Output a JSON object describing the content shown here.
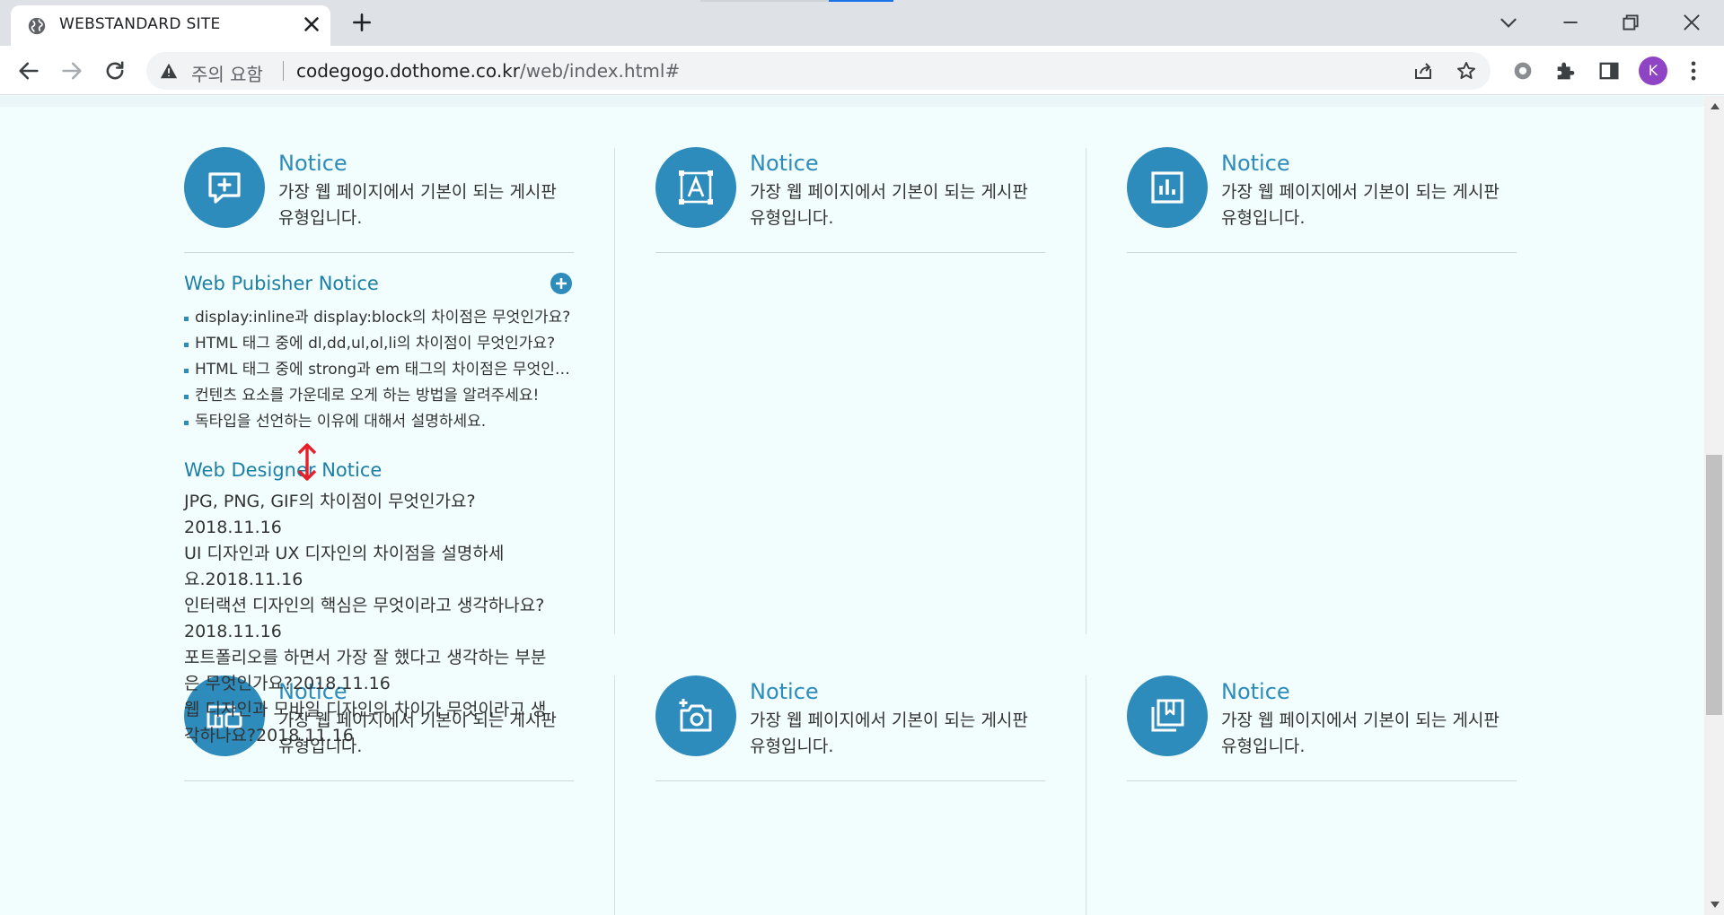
{
  "browser": {
    "tab_title": "WEBSTANDARD SITE",
    "security_label": "주의 요함",
    "url_domain": "codegogo.dothome.co.kr",
    "url_path": "/web/index.html#",
    "profile_initial": "K"
  },
  "notices": [
    {
      "icon": "chat-plus-icon",
      "title": "Notice",
      "desc": "가장 웹 페이지에서 기본이 되는 게시판 유형입니다."
    },
    {
      "icon": "text-frame-icon",
      "title": "Notice",
      "desc": "가장 웹 페이지에서 기본이 되는 게시판 유형입니다."
    },
    {
      "icon": "bar-chart-icon",
      "title": "Notice",
      "desc": "가장 웹 페이지에서 기본이 되는 게시판 유형입니다."
    },
    {
      "icon": "devices-icon",
      "title": "Notice",
      "desc": "가장 웹 페이지에서 기본이 되는 게시판 유형입니다."
    },
    {
      "icon": "camera-plus-icon",
      "title": "Notice",
      "desc": "가장 웹 페이지에서 기본이 되는 게시판 유형입니다."
    },
    {
      "icon": "bookmark-stack-icon",
      "title": "Notice",
      "desc": "가장 웹 페이지에서 기본이 되는 게시판 유형입니다."
    }
  ],
  "publisher": {
    "title": "Web Pubisher Notice",
    "items": [
      "display:inline과 display:block의 차이점은 무엇인가요?",
      "HTML 태그 중에 dl,dd,ul,ol,li의 차이점이 무엇인가요?",
      "HTML 태그 중에 strong과 em 태그의 차이점은 무엇인가요?",
      "컨텐츠 요소를 가운데로 오게 하는 방법을 알려주세요!",
      "독타입을 선언하는 이유에 대해서 설명하세요."
    ]
  },
  "designer": {
    "title": "Web Designer Notice",
    "items": [
      "JPG, PNG, GIF의 차이점이 무엇인가요?2018.11.16",
      "UI 디자인과 UX 디자인의 차이점을 설명하세요.2018.11.16",
      "인터랙션 디자인의 핵심은 무엇이라고 생각하나요?2018.11.16",
      "포트폴리오를 하면서 가장 잘 했다고 생각하는 부분은 무엇인가요?2018.11.16",
      "웹 디자인과 모바일 디자인의 차이가 무엇이라고 생각하나요?2018.11.16"
    ]
  },
  "colors": {
    "accent": "#2d8cbb",
    "page_bg": "#f2fdfd"
  }
}
